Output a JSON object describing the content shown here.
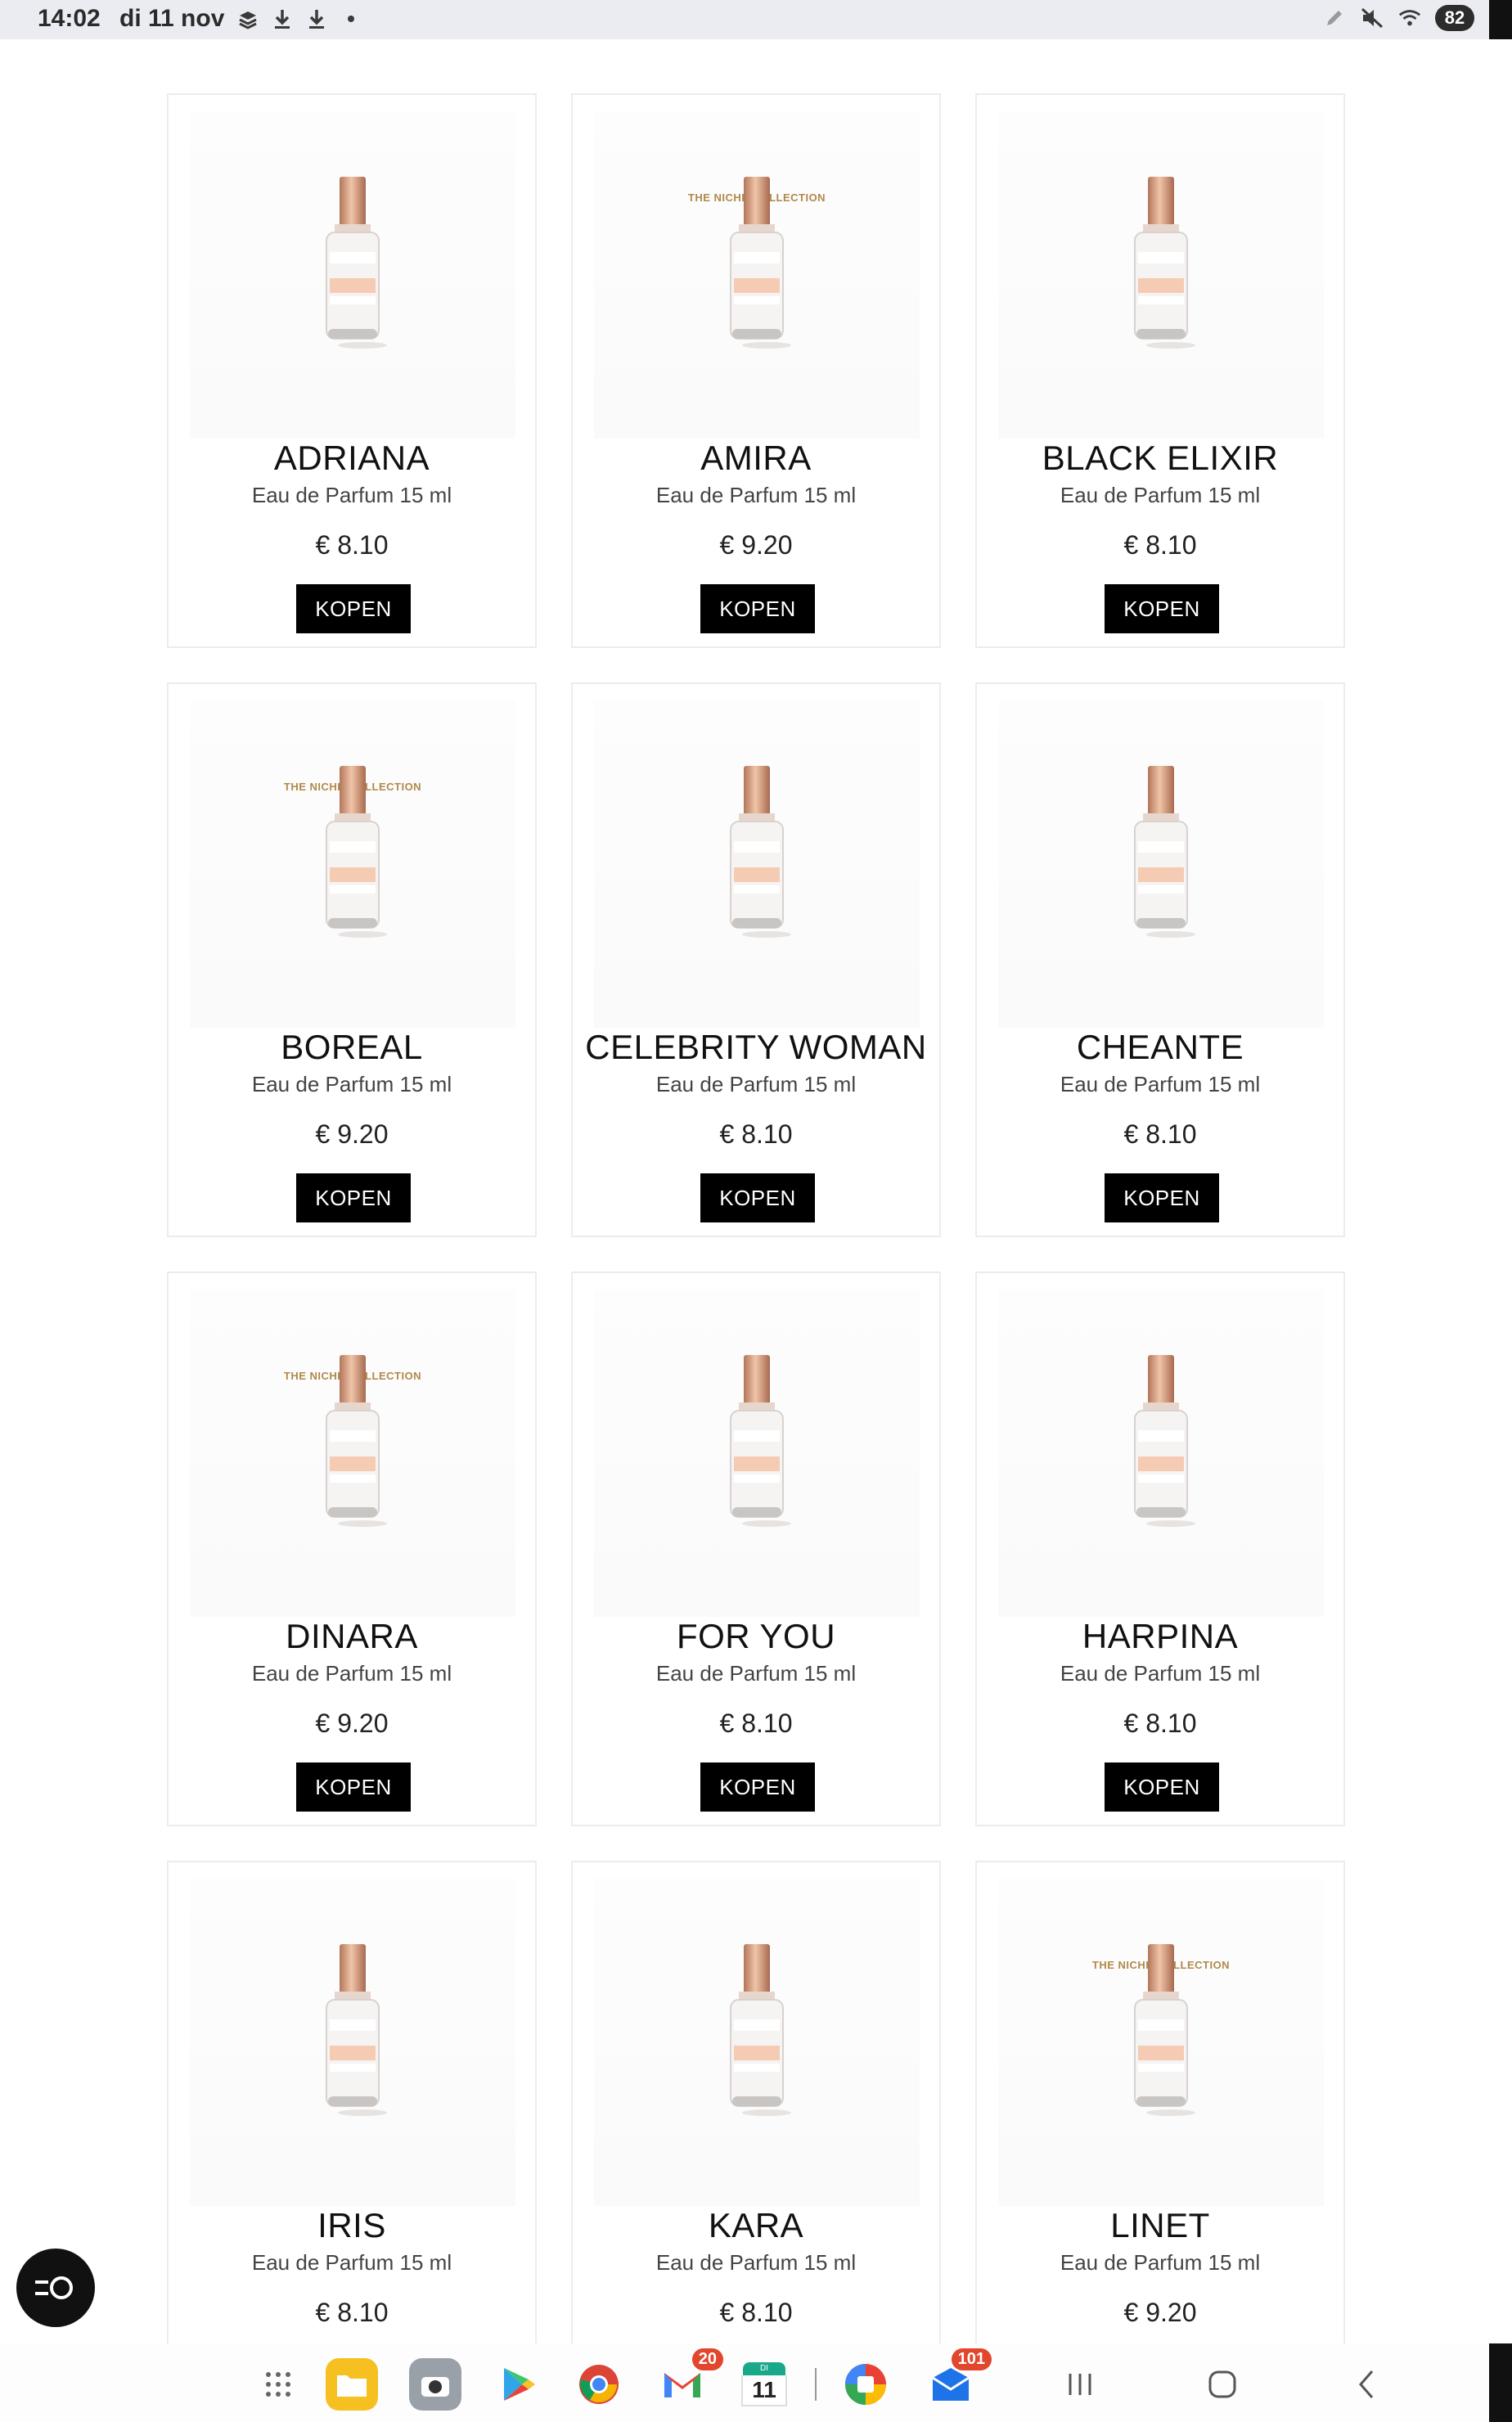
{
  "status_bar": {
    "time": "14:02",
    "date": "di 11 nov",
    "battery": "82",
    "left_icons": [
      "stack-icon",
      "download-icon",
      "download-icon",
      "dot-icon"
    ],
    "right_icons": [
      "pen-icon",
      "mute-icon",
      "wifi-icon"
    ]
  },
  "products": [
    {
      "name": "ADRIANA",
      "subtitle": "Eau de Parfum 15 ml",
      "price": "€ 8.10",
      "buy_label": "KOPEN",
      "niche": ""
    },
    {
      "name": "AMIRA",
      "subtitle": "Eau de Parfum 15 ml",
      "price": "€ 9.20",
      "buy_label": "KOPEN",
      "niche": "THE NICHE COLLECTION"
    },
    {
      "name": "BLACK ELIXIR",
      "subtitle": "Eau de Parfum 15 ml",
      "price": "€ 8.10",
      "buy_label": "KOPEN",
      "niche": ""
    },
    {
      "name": "BOREAL",
      "subtitle": "Eau de Parfum 15 ml",
      "price": "€ 9.20",
      "buy_label": "KOPEN",
      "niche": "THE NICHE COLLECTION"
    },
    {
      "name": "CELEBRITY WOMAN",
      "subtitle": "Eau de Parfum 15 ml",
      "price": "€ 8.10",
      "buy_label": "KOPEN",
      "niche": ""
    },
    {
      "name": "CHEANTE",
      "subtitle": "Eau de Parfum 15 ml",
      "price": "€ 8.10",
      "buy_label": "KOPEN",
      "niche": ""
    },
    {
      "name": "DINARA",
      "subtitle": "Eau de Parfum 15 ml",
      "price": "€ 9.20",
      "buy_label": "KOPEN",
      "niche": "THE NICHE COLLECTION"
    },
    {
      "name": "FOR YOU",
      "subtitle": "Eau de Parfum 15 ml",
      "price": "€ 8.10",
      "buy_label": "KOPEN",
      "niche": ""
    },
    {
      "name": "HARPINA",
      "subtitle": "Eau de Parfum 15 ml",
      "price": "€ 8.10",
      "buy_label": "KOPEN",
      "niche": ""
    },
    {
      "name": "IRIS",
      "subtitle": "Eau de Parfum 15 ml",
      "price": "€ 8.10",
      "buy_label": "",
      "niche": ""
    },
    {
      "name": "KARA",
      "subtitle": "Eau de Parfum 15 ml",
      "price": "€ 8.10",
      "buy_label": "",
      "niche": ""
    },
    {
      "name": "LINET",
      "subtitle": "Eau de Parfum 15 ml",
      "price": "€ 9.20",
      "buy_label": "",
      "niche": "THE NICHE COLLECTION"
    }
  ],
  "taskbar": {
    "gmail_badge": "20",
    "calendar_day": "11",
    "calendar_weekday": "DI",
    "mail_badge": "101"
  },
  "colors": {
    "button_bg": "#000000",
    "niche_gold": "#b0894a",
    "cap_copper": "#c98c6e",
    "status_bar_bg": "#ebecf2"
  }
}
